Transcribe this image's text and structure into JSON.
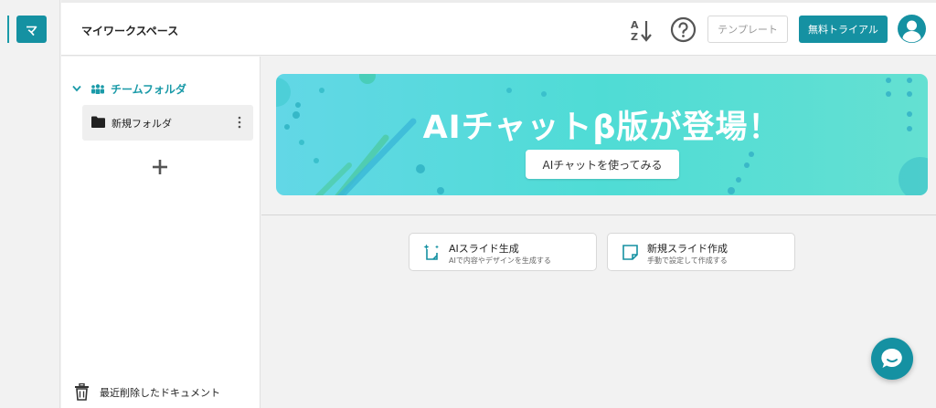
{
  "rail": {
    "workspace_initial": "マ"
  },
  "header": {
    "workspace_title": "マイワークスペース",
    "template_label": "テンプレート",
    "trial_label": "無料トライアル",
    "sort_icon": "sort-az-icon",
    "help_icon": "help-circle-icon",
    "user_icon": "user-avatar-icon"
  },
  "sidebar": {
    "team_folder_label": "チームフォルダ",
    "folders": [
      {
        "label": "新規フォルダ"
      }
    ],
    "trash_label": "最近削除したドキュメント"
  },
  "banner": {
    "title": "AIチャットβ版が登場！",
    "button_label": "AIチャットを使ってみる"
  },
  "actions": [
    {
      "title": "AIスライド生成",
      "subtitle": "AIで内容やデザインを生成する",
      "icon": "ai-slide-icon"
    },
    {
      "title": "新規スライド作成",
      "subtitle": "手動で設定して作成する",
      "icon": "new-slide-icon"
    }
  ],
  "colors": {
    "accent": "#1591a2",
    "team_label": "#1a9aa8",
    "background": "#f2f2f2"
  }
}
